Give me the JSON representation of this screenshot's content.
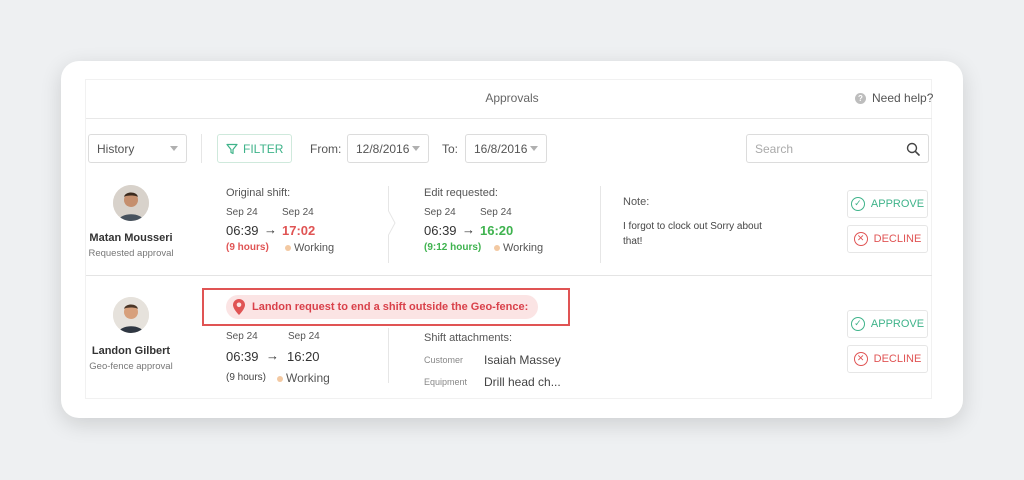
{
  "header": {
    "title": "Approvals",
    "help": "Need help?"
  },
  "toolbar": {
    "history": "History",
    "filter": "FILTER",
    "from_label": "From:",
    "from_value": "12/8/2016",
    "to_label": "To:",
    "to_value": "16/8/2016",
    "search_placeholder": "Search"
  },
  "requests": [
    {
      "name": "Matan Mousseri",
      "type": "Requested approval",
      "original": {
        "label": "Original shift:",
        "date_start": "Sep 24",
        "date_end": "Sep 24",
        "time_start": "06:39",
        "time_end": "17:02",
        "duration": "(9 hours)",
        "status": "Working"
      },
      "edit": {
        "label": "Edit requested:",
        "date_start": "Sep 24",
        "date_end": "Sep 24",
        "time_start": "06:39",
        "time_end": "16:20",
        "duration": "(9:12 hours)",
        "status": "Working"
      },
      "note_label": "Note:",
      "note_text": "I forgot to clock out Sorry about that!",
      "approve": "APPROVE",
      "decline": "DECLINE"
    },
    {
      "name": "Landon Gilbert",
      "type": "Geo-fence approval",
      "alert": "Landon request to end a shift outside the Geo-fence:",
      "shift": {
        "date_start": "Sep 24",
        "date_end": "Sep 24",
        "time_start": "06:39",
        "time_end": "16:20",
        "duration": "(9 hours)",
        "status": "Working"
      },
      "attachments_label": "Shift attachments:",
      "customer_label": "Customer",
      "customer_value": "Isaiah Massey",
      "equipment_label": "Equipment",
      "equipment_value": "Drill head ch...",
      "approve": "APPROVE",
      "decline": "DECLINE"
    }
  ],
  "colors": {
    "accent_green": "#3fb38a",
    "accent_red": "#e05454",
    "background": "#eef0f2"
  }
}
